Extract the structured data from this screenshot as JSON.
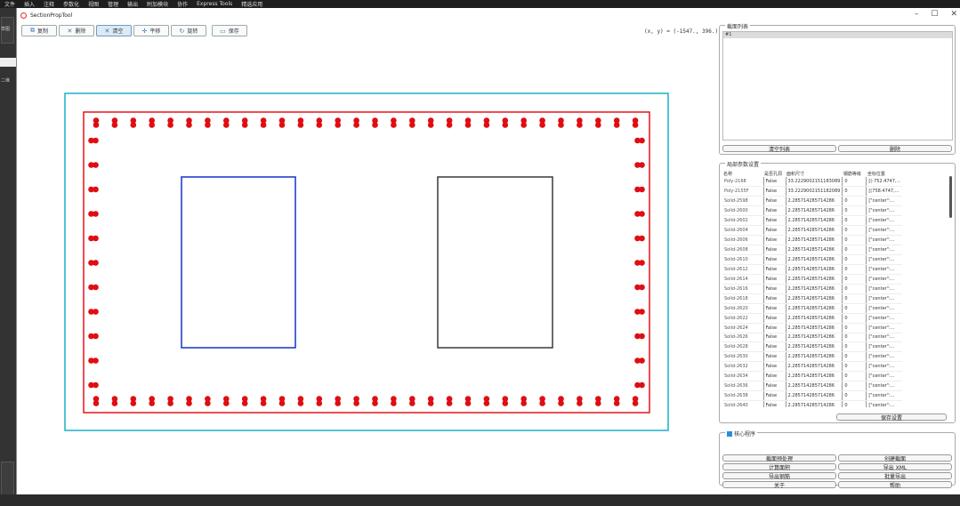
{
  "cad_menu": {
    "items": [
      "文件",
      "插入",
      "注释",
      "参数化",
      "视图",
      "管理",
      "输出",
      "附加模块",
      "协作",
      "Express Tools",
      "精选应用"
    ]
  },
  "cad_left": {
    "labels": [
      "草图",
      "二维"
    ]
  },
  "window": {
    "title": "SectionPropTool",
    "minimize": "–",
    "maximize": "☐",
    "close": "✕"
  },
  "toolbar": {
    "buttons": [
      {
        "label": "复制",
        "icon": "copy-icon",
        "glyph": "⧉"
      },
      {
        "label": "删除",
        "icon": "close-x-icon",
        "glyph": "✕"
      },
      {
        "label": "清空",
        "icon": "clear-icon",
        "glyph": "✕"
      },
      {
        "label": "平移",
        "icon": "move-icon",
        "glyph": "✛"
      },
      {
        "label": "旋转",
        "icon": "rotate-icon",
        "glyph": "↻"
      },
      {
        "label": "保存",
        "icon": "save-icon",
        "glyph": "▭"
      }
    ]
  },
  "coords": {
    "text": "(x, y) = (-1547., 396.)"
  },
  "colors": {
    "outer": "#1ab0c8",
    "section": "#e8131b",
    "rebar": "#e00d12",
    "hole1": "#1432c8",
    "hole2": "#3a3a3a"
  },
  "section_list": {
    "title": "截面列表",
    "selected": "#1",
    "clear_button": "清空列表",
    "delete_button": "删除"
  },
  "local_params": {
    "title": "局部参数设置",
    "columns": [
      "名称",
      "是否孔洞",
      "面积尺寸",
      "钢筋等级",
      "坐标位置"
    ],
    "rows": [
      [
        "Poly-2168",
        "False",
        "33.2229002151183089",
        "0",
        "[(-752.4747,..."
      ],
      [
        "Poly-2155F",
        "False",
        "33.2229002151182089",
        "0",
        "[(758.4747,..."
      ],
      [
        "Solid-2598",
        "False",
        "2.285714285714286",
        "0",
        "[\"center\":..."
      ],
      [
        "Solid-2600",
        "False",
        "2.285714285714286",
        "0",
        "[\"center\":..."
      ],
      [
        "Solid-2602",
        "False",
        "2.285714285714286",
        "0",
        "[\"center\":..."
      ],
      [
        "Solid-2604",
        "False",
        "2.285714285714286",
        "0",
        "[\"center\":..."
      ],
      [
        "Solid-2606",
        "False",
        "2.285714285714286",
        "0",
        "[\"center\":..."
      ],
      [
        "Solid-2608",
        "False",
        "2.285714285714286",
        "0",
        "[\"center\":..."
      ],
      [
        "Solid-2610",
        "False",
        "2.285714285714286",
        "0",
        "[\"center\":..."
      ],
      [
        "Solid-2612",
        "False",
        "2.285714285714286",
        "0",
        "[\"center\":..."
      ],
      [
        "Solid-2614",
        "False",
        "2.285714285714286",
        "0",
        "[\"center\":..."
      ],
      [
        "Solid-2616",
        "False",
        "2.285714285714286",
        "0",
        "[\"center\":..."
      ],
      [
        "Solid-2618",
        "False",
        "2.285714285714286",
        "0",
        "[\"center\":..."
      ],
      [
        "Solid-2620",
        "False",
        "2.285714285714286",
        "0",
        "[\"center\":..."
      ],
      [
        "Solid-2622",
        "False",
        "2.285714285714286",
        "0",
        "[\"center\":..."
      ],
      [
        "Solid-2624",
        "False",
        "2.285714285714286",
        "0",
        "[\"center\":..."
      ],
      [
        "Solid-2626",
        "False",
        "2.285714285714286",
        "0",
        "[\"center\":..."
      ],
      [
        "Solid-2628",
        "False",
        "2.285714285714286",
        "0",
        "[\"center\":..."
      ],
      [
        "Solid-2630",
        "False",
        "2.285714285714286",
        "0",
        "[\"center\":..."
      ],
      [
        "Solid-2632",
        "False",
        "2.285714285714286",
        "0",
        "[\"center\":..."
      ],
      [
        "Solid-2634",
        "False",
        "2.285714285714286",
        "0",
        "[\"center\":..."
      ],
      [
        "Solid-2636",
        "False",
        "2.285714285714286",
        "0",
        "[\"center\":..."
      ],
      [
        "Solid-2638",
        "False",
        "2.285714285714286",
        "0",
        "[\"center\":..."
      ],
      [
        "Solid-2640",
        "False",
        "2.285714285714286",
        "0",
        "[\"center\":..."
      ]
    ],
    "save_button": "保存设置"
  },
  "core_features": {
    "title": "核心程序",
    "buttons": [
      "截面预处理",
      "创建截面",
      "计算面积",
      "导出 XML",
      "导出钢筋",
      "批量导出",
      "关于",
      "帮助"
    ]
  }
}
